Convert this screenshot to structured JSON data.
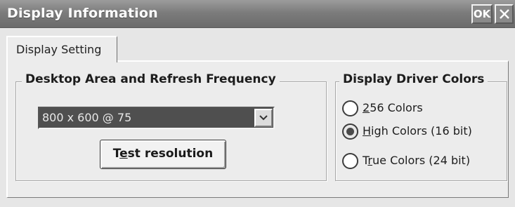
{
  "window": {
    "title": "Display Information",
    "ok_label": "OK",
    "close_icon": "close-icon"
  },
  "tabs": [
    {
      "label": "Display Setting",
      "selected": true
    }
  ],
  "desktop_area": {
    "group_title": "Desktop Area and Refresh Frequency",
    "resolution_value": "800 x 600 @ 75",
    "dropdown_icon": "chevron-down-icon",
    "test_button": {
      "label_before": "T",
      "label_mnemonic": "e",
      "label_after": "st resolution"
    }
  },
  "driver_colors": {
    "group_title": "Display Driver Colors",
    "options": [
      {
        "prefix": "",
        "mnemonic": "2",
        "suffix": "56 Colors",
        "selected": false
      },
      {
        "prefix": "",
        "mnemonic": "H",
        "suffix": "igh Colors (16 bit)",
        "selected": true
      },
      {
        "prefix": "T",
        "mnemonic": "r",
        "suffix": "ue Colors (24 bit)",
        "selected": false
      }
    ]
  },
  "colors": {
    "titlebar": "#7c7c7c",
    "dialog_bg": "#e6e6e6",
    "dropdown_selected_bg": "#4f4f4f"
  }
}
